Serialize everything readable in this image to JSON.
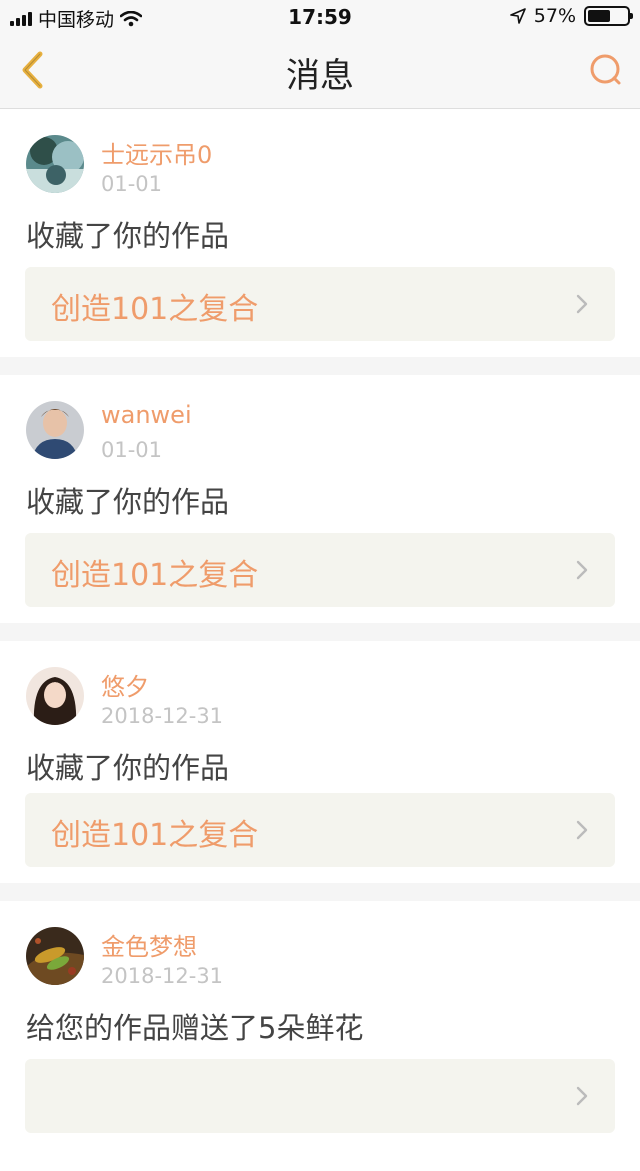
{
  "status_bar": {
    "carrier": "中国移动",
    "time": "17:59",
    "battery_text": "57%",
    "battery_level": 0.57
  },
  "nav": {
    "title": "消息",
    "back_icon": "chevron-left-icon",
    "search_icon": "search-icon"
  },
  "colors": {
    "accent": "#ef9c6b",
    "back_icon": "#e7b03f",
    "card_bg": "#f4f4ee"
  },
  "messages": [
    {
      "name": "士远示吊0",
      "date": "01-01",
      "message": "收藏了你的作品",
      "work_title": "创造101之复合"
    },
    {
      "name": "wanwei",
      "date": "01-01",
      "message": "收藏了你的作品",
      "work_title": "创造101之复合"
    },
    {
      "name": "悠夕",
      "date": "2018-12-31",
      "message": "收藏了你的作品",
      "work_title": "创造101之复合"
    },
    {
      "name": "金色梦想",
      "date": "2018-12-31",
      "message": "给您的作品赠送了5朵鲜花",
      "work_title": ""
    }
  ]
}
